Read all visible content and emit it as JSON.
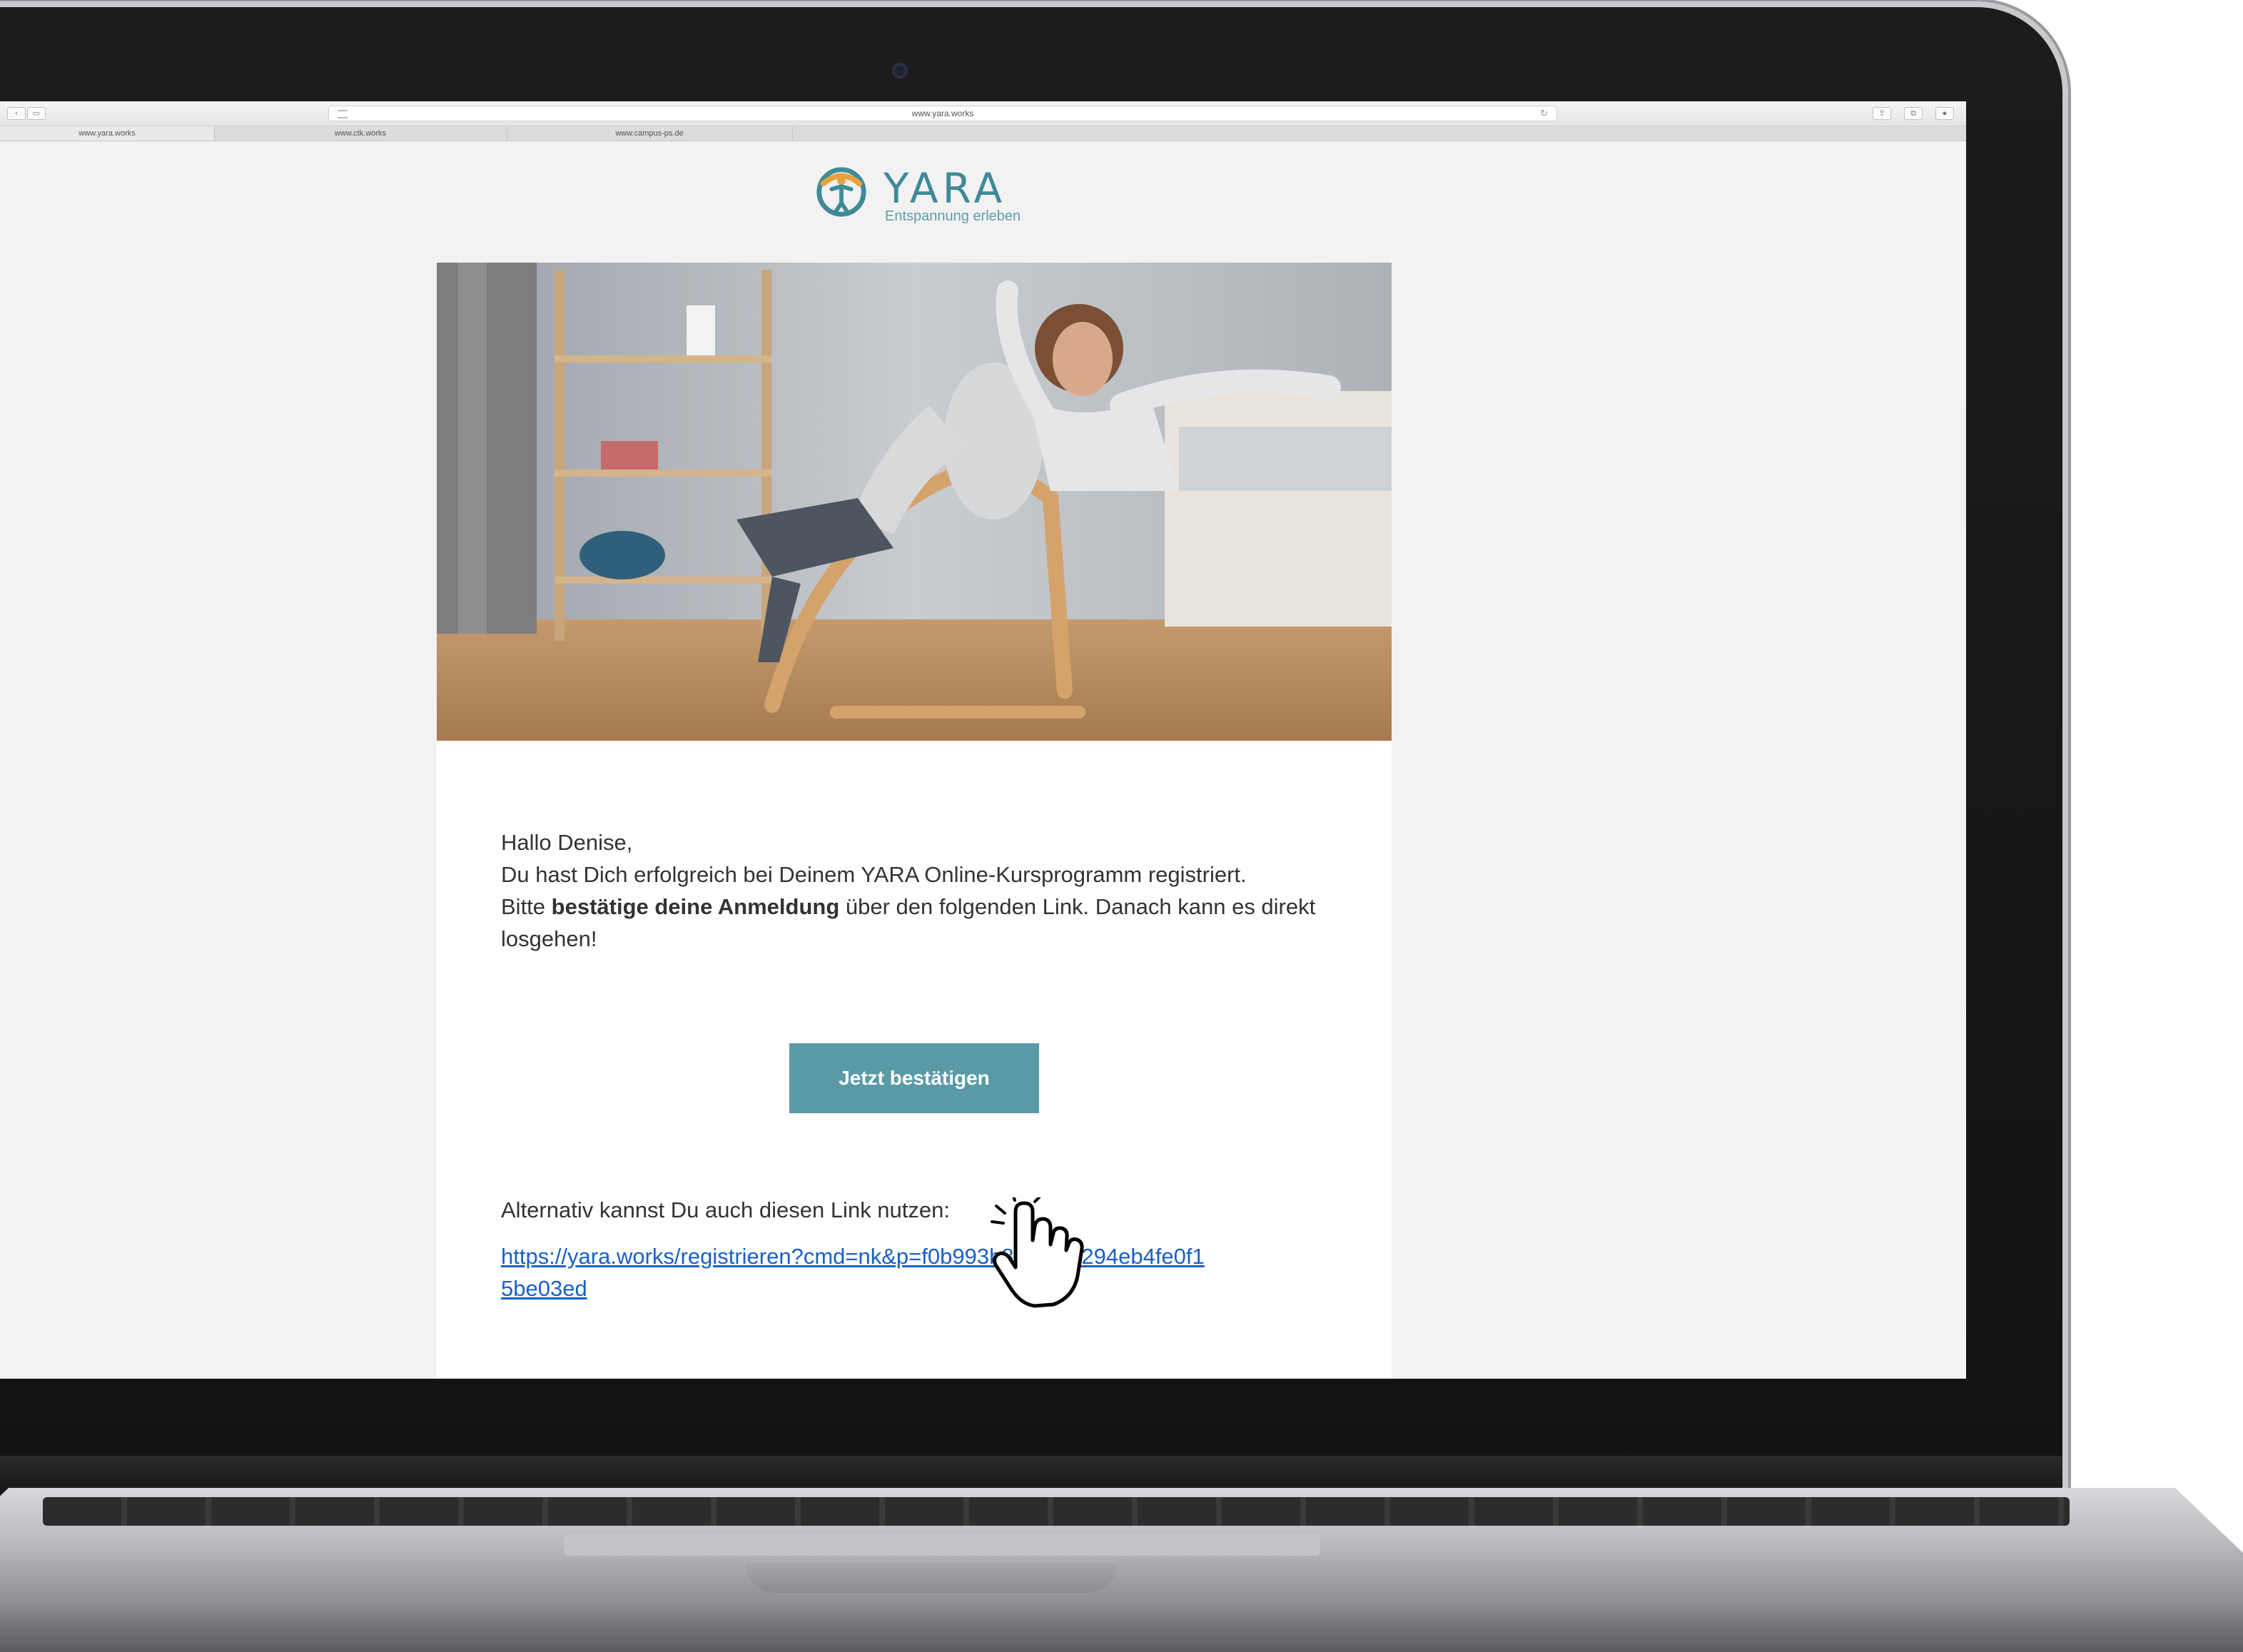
{
  "browser": {
    "url": "www.yara.works",
    "tabs": [
      {
        "label": "www.yara.works",
        "active": true
      },
      {
        "label": "www.ctk.works",
        "active": false
      },
      {
        "label": "www.campus-ps.de",
        "active": false
      }
    ]
  },
  "brand": {
    "name": "YARA",
    "tagline": "Entspannung erleben",
    "color": "#3f8a98",
    "accent": "#e8a13b"
  },
  "email": {
    "greeting": "Hallo Denise,",
    "line1": "Du hast Dich erfolgreich bei Deinem YARA Online-Kursprogramm registriert.",
    "line2_prefix": "Bitte ",
    "line2_bold": "bestätige deine Anmeldung",
    "line2_suffix": " über den folgenden Link. Danach kann es direkt losgehen!",
    "button_label": "Jetzt bestätigen",
    "button_color": "#5a9aa6",
    "alt_text": "Alternativ kannst Du auch diesen Link nutzen:",
    "link": "https://yara.works/registrieren?cmd=nk&p=f0b993b8a6d8f0294eb4fe0f15be03ed"
  },
  "icons": [
    "reader-icon",
    "reload-icon",
    "hand-pointer-icon",
    "yara-logo-mark"
  ]
}
